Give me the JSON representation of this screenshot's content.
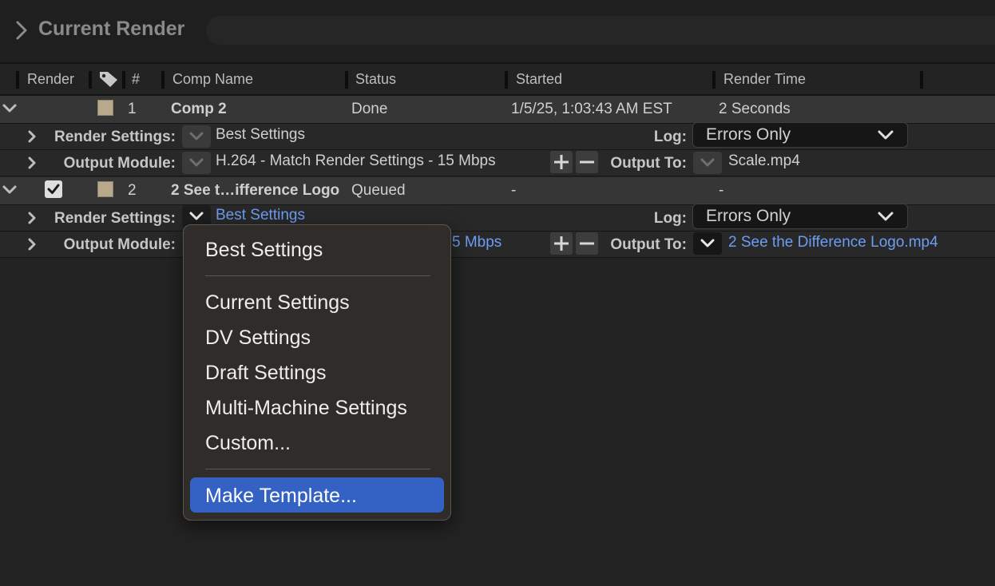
{
  "panel": {
    "title": "Current Render"
  },
  "columns": {
    "render": "Render",
    "label_icon": "tag-icon",
    "number": "#",
    "comp_name": "Comp Name",
    "status": "Status",
    "started": "Started",
    "render_time": "Render Time"
  },
  "items": [
    {
      "number": "1",
      "comp_name": "Comp 2",
      "status": "Done",
      "started": "1/5/25, 1:03:43 AM EST",
      "render_time": "2 Seconds",
      "render_checked": false,
      "render_settings_label": "Render Settings:",
      "render_settings_value": "Best Settings",
      "log_label": "Log:",
      "log_value": "Errors Only",
      "output_module_label": "Output Module:",
      "output_module_value": "H.264 - Match Render Settings - 15 Mbps",
      "output_to_label": "Output To:",
      "output_to_value": "Scale.mp4"
    },
    {
      "number": "2",
      "comp_name": "2 See t…ifference Logo",
      "status": "Queued",
      "started": "-",
      "render_time": "-",
      "render_checked": true,
      "render_settings_label": "Render Settings:",
      "render_settings_value": "Best Settings",
      "log_label": "Log:",
      "log_value": "Errors Only",
      "output_module_label": "Output Module:",
      "output_module_value_visible": "5 Mbps",
      "output_to_label": "Output To:",
      "output_to_value": "2 See the Difference Logo.mp4"
    }
  ],
  "dropdown_menu": {
    "items": [
      "Best Settings",
      "Current Settings",
      "DV Settings",
      "Draft Settings",
      "Multi-Machine Settings",
      "Custom...",
      "Make Template..."
    ],
    "highlighted": "Make Template..."
  },
  "colors": {
    "background": "#232323",
    "link": "#6d9cf2",
    "menu_highlight": "#3461c4",
    "label_swatch": "#b8a98c"
  }
}
